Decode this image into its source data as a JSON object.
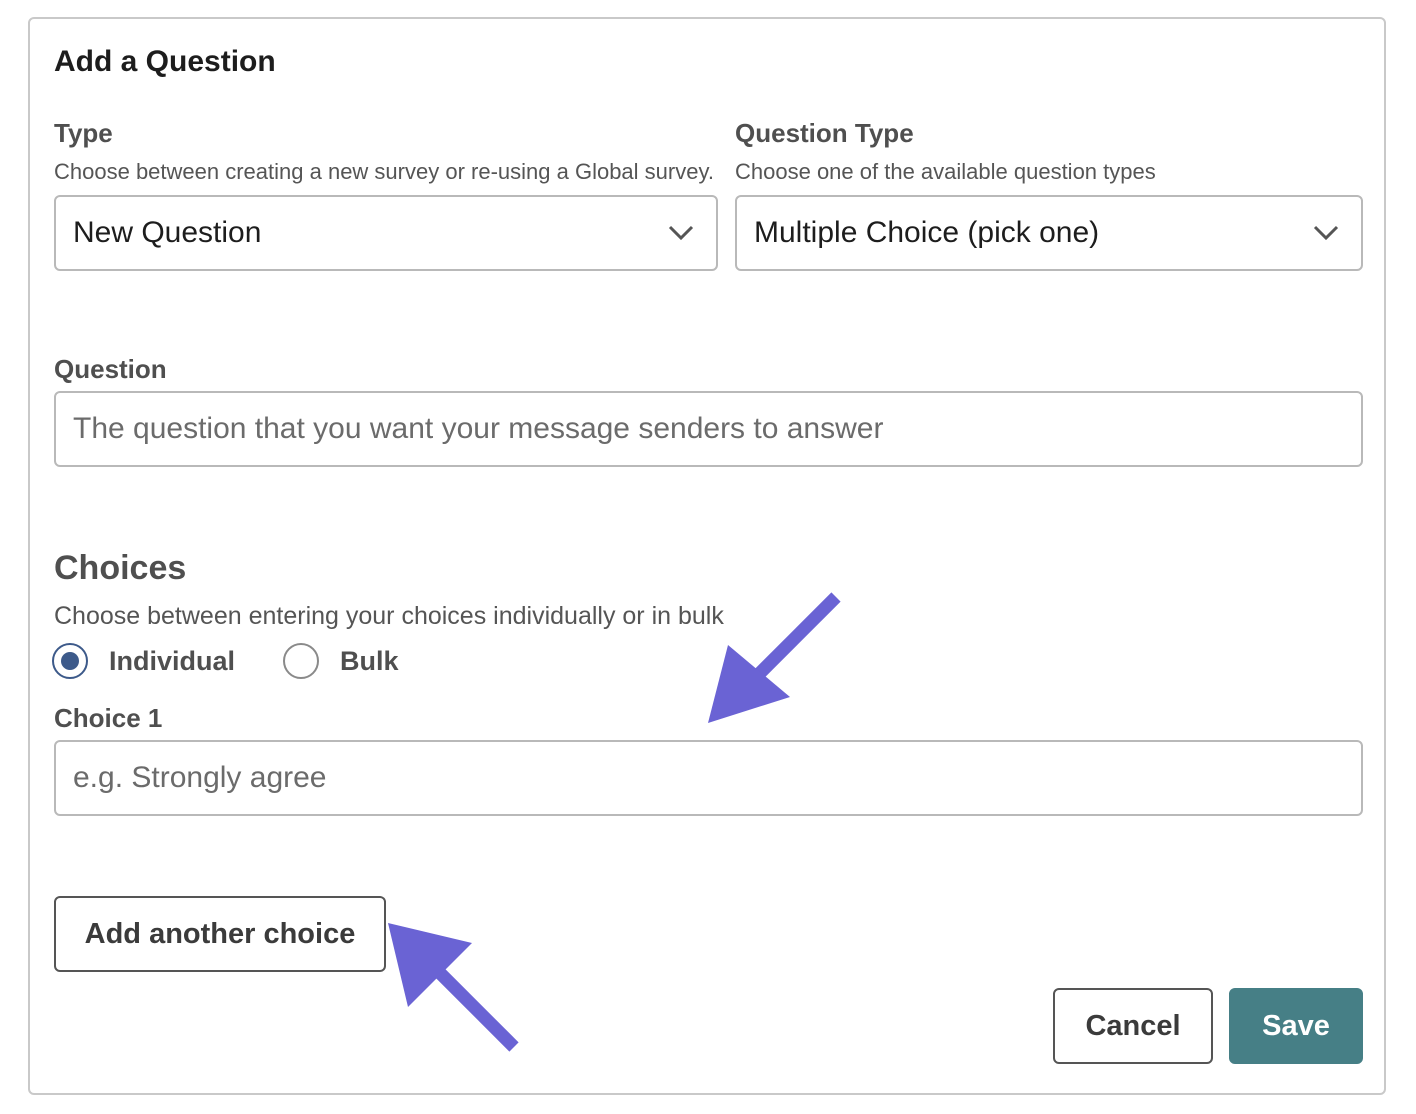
{
  "form": {
    "title": "Add a Question",
    "type": {
      "label": "Type",
      "helper": "Choose between creating a new survey or re-using a Global survey.",
      "selected": "New Question"
    },
    "question_type": {
      "label": "Question Type",
      "helper": "Choose one of the available question types",
      "selected": "Multiple Choice (pick one)"
    },
    "question": {
      "label": "Question",
      "placeholder": "The question that you want your message senders to answer",
      "value": ""
    },
    "choices": {
      "title": "Choices",
      "helper": "Choose between entering your choices individually or in bulk",
      "mode_options": [
        {
          "label": "Individual",
          "checked": true
        },
        {
          "label": "Bulk",
          "checked": false
        }
      ],
      "choice1_label": "Choice 1",
      "choice1_placeholder": "e.g. Strongly agree",
      "add_label": "Add another choice"
    },
    "actions": {
      "cancel_label": "Cancel",
      "save_label": "Save"
    }
  },
  "colors": {
    "accent": "#467f86",
    "radio": "#3d5a8a",
    "annotation_arrow": "#6a63d4"
  },
  "icons": {
    "dropdown": "chevron-down-icon",
    "annotation": "arrow-icon"
  }
}
